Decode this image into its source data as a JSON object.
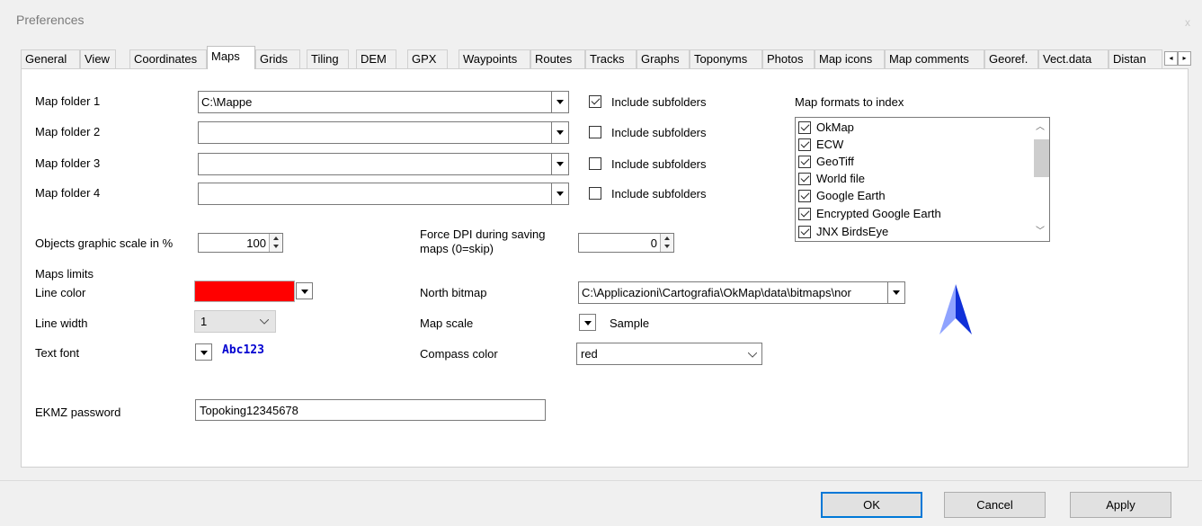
{
  "window": {
    "title": "Preferences",
    "close": "x"
  },
  "tabs": [
    {
      "label": "General"
    },
    {
      "label": "View"
    },
    {
      "label": "Coordinates"
    },
    {
      "label": "Maps",
      "active": true
    },
    {
      "label": "Grids"
    },
    {
      "label": "Tiling"
    },
    {
      "label": "DEM"
    },
    {
      "label": "GPX"
    },
    {
      "label": "Waypoints"
    },
    {
      "label": "Routes"
    },
    {
      "label": "Tracks"
    },
    {
      "label": "Graphs"
    },
    {
      "label": "Toponyms"
    },
    {
      "label": "Photos"
    },
    {
      "label": "Map icons"
    },
    {
      "label": "Map comments"
    },
    {
      "label": "Georef."
    },
    {
      "label": "Vect.data"
    },
    {
      "label": "Distan"
    }
  ],
  "tab_scroll": {
    "left": "◂",
    "right": "▸"
  },
  "maps": {
    "folders": [
      {
        "label": "Map folder 1",
        "value": "C:\\Mappe",
        "include_label": "Include subfolders",
        "include": true
      },
      {
        "label": "Map folder 2",
        "value": "",
        "include_label": "Include subfolders",
        "include": false
      },
      {
        "label": "Map folder 3",
        "value": "",
        "include_label": "Include subfolders",
        "include": false
      },
      {
        "label": "Map folder 4",
        "value": "",
        "include_label": "Include subfolders",
        "include": false
      }
    ],
    "formats_label": "Map formats to index",
    "formats": [
      {
        "label": "OkMap",
        "checked": true
      },
      {
        "label": "ECW",
        "checked": true
      },
      {
        "label": "GeoTiff",
        "checked": true
      },
      {
        "label": "World file",
        "checked": true
      },
      {
        "label": "Google Earth",
        "checked": true
      },
      {
        "label": "Encrypted Google Earth",
        "checked": true
      },
      {
        "label": "JNX BirdsEye",
        "checked": true
      }
    ],
    "scale_label": "Objects graphic scale in %",
    "scale_value": "100",
    "dpi_label_line1": "Force DPI during saving",
    "dpi_label_line2": "maps (0=skip)",
    "dpi_value": "0",
    "limits_label": "Maps limits",
    "line_color_label": "Line color",
    "line_color": "#ff0000",
    "line_width_label": "Line width",
    "line_width_value": "1",
    "text_font_label": "Text font",
    "text_font_sample": "Abc123",
    "north_bitmap_label": "North bitmap",
    "north_bitmap_value": "C:\\Applicazioni\\Cartografia\\OkMap\\data\\bitmaps\\nor",
    "map_scale_label": "Map scale",
    "map_scale_sample": "Sample",
    "compass_color_label": "Compass color",
    "compass_color_value": "red",
    "ekmz_label": "EKMZ password",
    "ekmz_value": "Topoking12345678"
  },
  "buttons": {
    "ok": "OK",
    "cancel": "Cancel",
    "apply": "Apply"
  },
  "icons": {
    "north": "north-arrow-icon",
    "dropdown": "chevron-down-icon"
  }
}
